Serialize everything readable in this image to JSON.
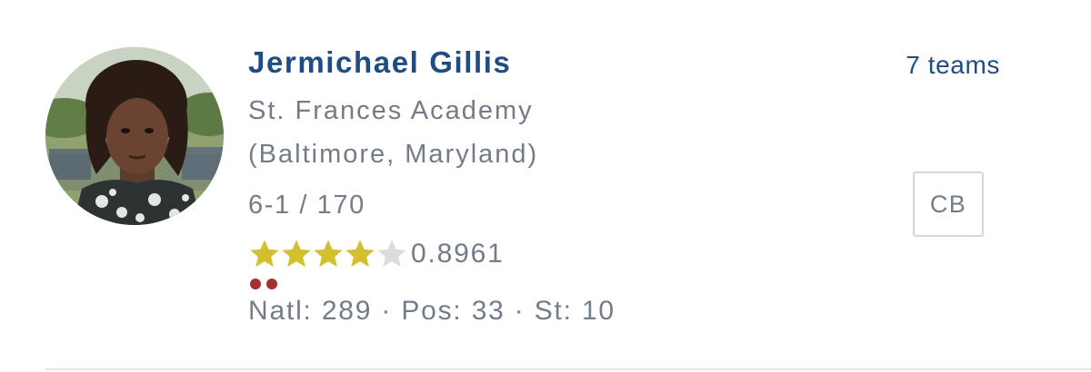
{
  "player": {
    "name": "Jermichael Gillis",
    "school": "St. Frances Academy",
    "location": "(Baltimore, Maryland)",
    "height_weight": "6-1 / 170",
    "stars": 4,
    "max_stars": 5,
    "rating": "0.8961",
    "ranks": "Natl: 289 · Pos: 33 · St: 10",
    "position": "CB",
    "teams": "7 teams",
    "indicator_dots": 2
  },
  "colors": {
    "name": "#1f4d82",
    "text": "#737c88",
    "star_filled": "#d4c02e",
    "star_empty": "#dcdcdc",
    "dot": "#a3302f",
    "badge_border": "#d4d8dc",
    "divider": "#e3e5e8"
  },
  "icons": {
    "avatar": "player-photo",
    "star": "star-icon"
  }
}
